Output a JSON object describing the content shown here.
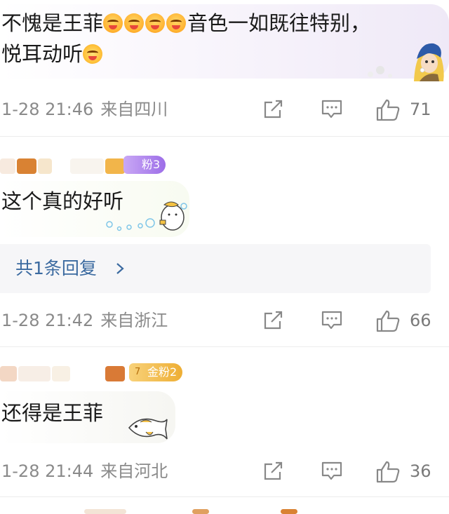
{
  "comments": [
    {
      "text": "不愧是王菲",
      "text_after": "音色一如既往特别，",
      "text_line2": "悦耳动听",
      "emoji_count": 4,
      "date": "1-28 21:46",
      "location": "来自四川",
      "likes": "71"
    },
    {
      "fan_badge": "粉3",
      "text": "这个真的好听",
      "replies": "共1条回复",
      "date": "1-28 21:42",
      "location": "来自浙江",
      "likes": "66"
    },
    {
      "fan_badge": "金粉2",
      "fan_level": "7",
      "text": "还得是王菲",
      "date": "1-28 21:44",
      "location": "来自河北",
      "likes": "36"
    }
  ],
  "icons": {
    "share": "share-icon",
    "comment": "comment-icon",
    "like": "thumbs-up-icon",
    "chevron": "chevron-right-icon"
  },
  "colors": {
    "meta_text": "#8a8a8a",
    "reply_link": "#3b6aa0",
    "fan_badge_purple": "#b48cf0",
    "fan_badge_gold": "#f0b43c"
  }
}
